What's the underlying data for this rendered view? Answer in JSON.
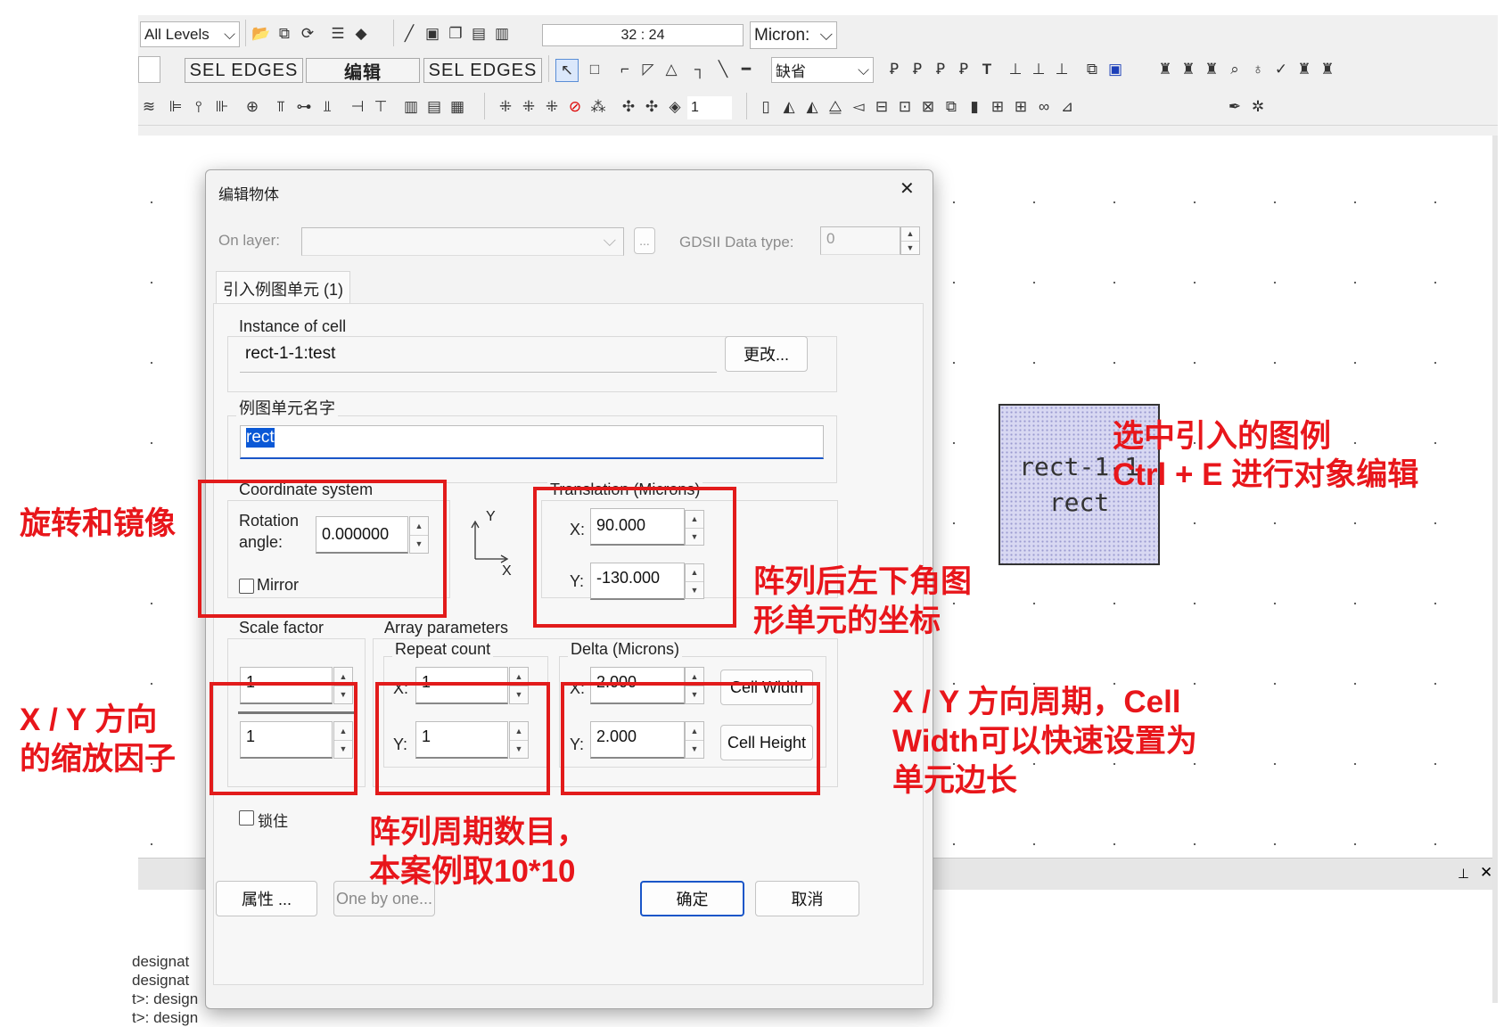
{
  "toolbar": {
    "levels_combo": "All Levels",
    "time": "32 : 24",
    "units_combo": "Micron:",
    "sel_edges_1": "SEL EDGES",
    "edit_label": "编辑",
    "sel_edges_2": "SEL EDGES",
    "default_combo": "缺省",
    "count_value": "1"
  },
  "cell": {
    "line1": "rect-1-1",
    "line2": "rect"
  },
  "bottom_panel": {
    "lines": [
      "designat",
      "designat",
      "t>: design",
      "t>: design"
    ]
  },
  "dialog": {
    "title": "编辑物体",
    "on_layer_label": "On layer:",
    "browse_label": "...",
    "gdsii_label": "GDSII Data type:",
    "gdsii_value": "0",
    "tab_label": "引入例图单元 (1)",
    "instance_group": "Instance of cell",
    "instance_value": "rect-1-1:test",
    "change_button": "更改...",
    "cell_name_group": "例图单元名字",
    "cell_name_value": "rect",
    "coord_group": "Coordinate system",
    "rotation_label_1": "Rotation",
    "rotation_label_2": "angle:",
    "rotation_value": "0.000000",
    "mirror_label": "Mirror",
    "axis_y": "Y",
    "axis_x": "X",
    "translation_group": "Translation (Microns)",
    "tx_label": "X:",
    "tx_value": "90.000",
    "ty_label": "Y:",
    "ty_value": "-130.000",
    "scale_group": "Scale factor",
    "scale_x": "1",
    "scale_y": "1",
    "array_group": "Array parameters",
    "repeat_group": "Repeat count",
    "rx_label": "X:",
    "rx_value": "1",
    "ry_label": "Y:",
    "ry_value": "1",
    "delta_group": "Delta (Microns)",
    "dx_label": "X:",
    "dx_value": "2.000",
    "dy_label": "Y:",
    "dy_value": "2.000",
    "cell_width_button": "Cell Width",
    "cell_height_button": "Cell Height",
    "lock_label": "锁住",
    "properties_button": "属性 ...",
    "one_by_one_button": "One by one...",
    "ok_button": "确定",
    "cancel_button": "取消",
    "close_glyph": "✕"
  },
  "annotations": {
    "select_hint_1": "选中引入的图例",
    "select_hint_2": "Ctrl + E 进行对象编辑",
    "rotate_mirror": "旋转和镜像",
    "translation_1": "阵列后左下角图",
    "translation_2": "形单元的坐标",
    "scale_1": "X / Y 方向",
    "scale_2": "的缩放因子",
    "period_1": "X / Y 方向周期，Cell",
    "period_2": "Width可以快速设置为",
    "period_3": "单元边长",
    "count_1": "阵列周期数目，",
    "count_2": "本案例取10*10"
  },
  "colors": {
    "annotation_red": "#e8161b",
    "selection_blue": "#0a58d6",
    "cell_fill": "#d8d8f2"
  }
}
